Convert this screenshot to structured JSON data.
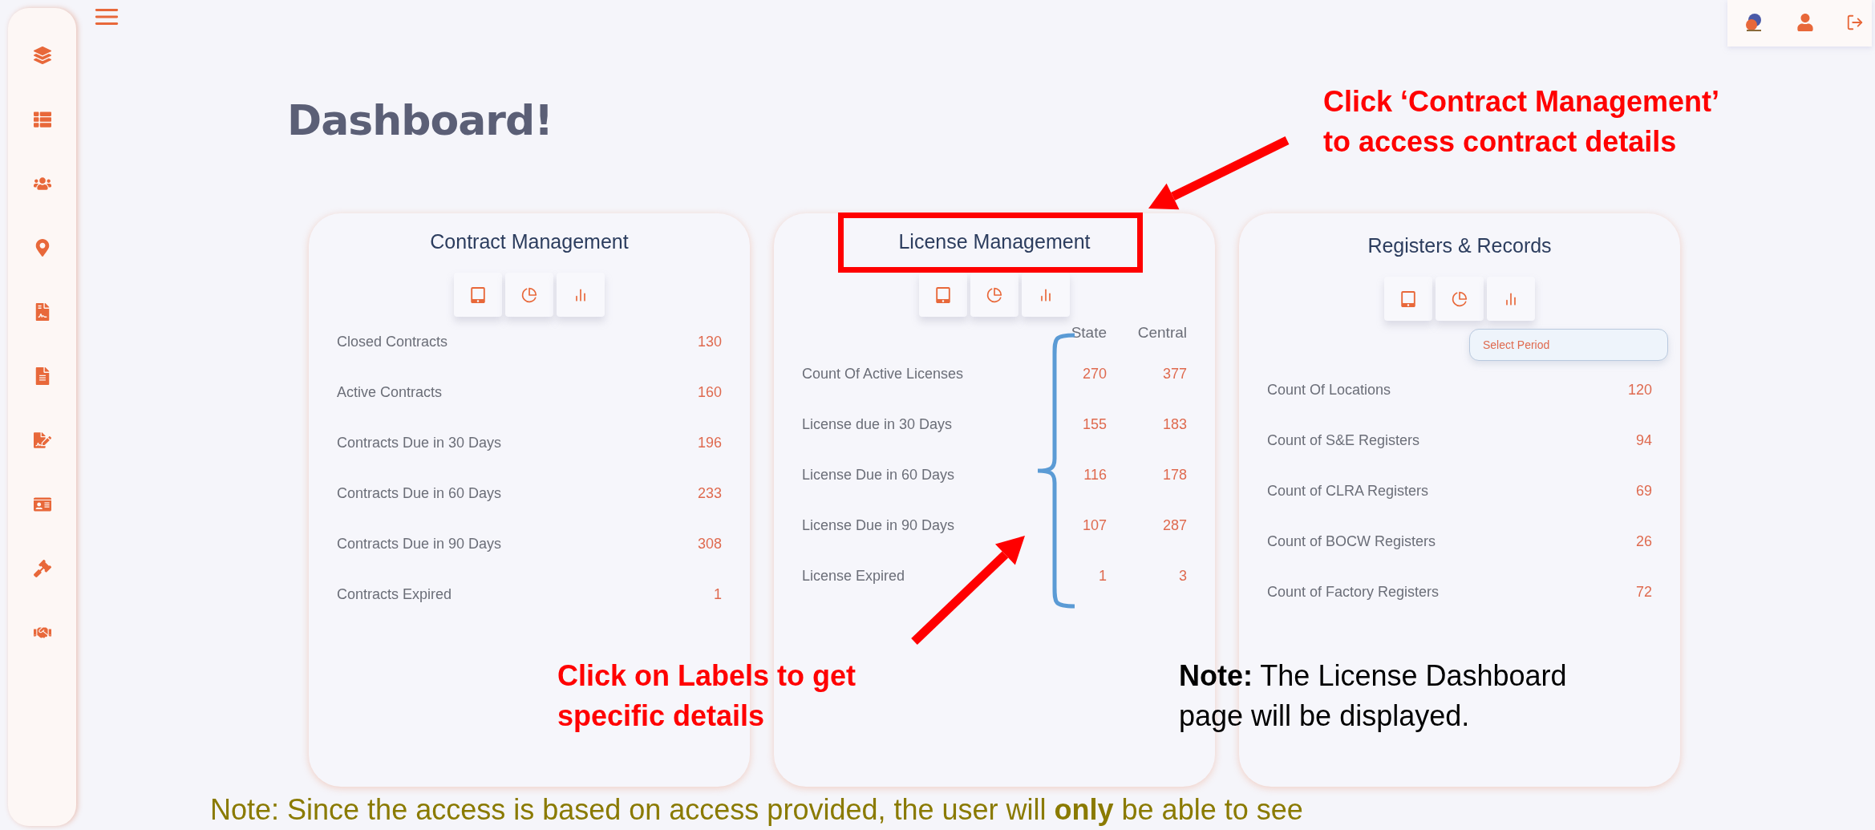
{
  "page_title": "Dashboard!",
  "cards": [
    {
      "kind": "single",
      "title": "Contract Management",
      "rows": [
        {
          "label": "Closed Contracts",
          "value": "130"
        },
        {
          "label": "Active Contracts",
          "value": "160"
        },
        {
          "label": "Contracts Due in 30 Days",
          "value": "196"
        },
        {
          "label": "Contracts Due in 60 Days",
          "value": "233"
        },
        {
          "label": "Contracts Due in 90 Days",
          "value": "308"
        },
        {
          "label": "Contracts Expired",
          "value": "1"
        }
      ]
    },
    {
      "kind": "dual",
      "title": "License Management",
      "columns": [
        "State",
        "Central"
      ],
      "rows": [
        {
          "label": "Count Of Active Licenses",
          "values": [
            "270",
            "377"
          ]
        },
        {
          "label": "License due in 30 Days",
          "values": [
            "155",
            "183"
          ]
        },
        {
          "label": "License Due in 60 Days",
          "values": [
            "116",
            "178"
          ]
        },
        {
          "label": "License Due in 90 Days",
          "values": [
            "107",
            "287"
          ]
        },
        {
          "label": "License Expired",
          "values": [
            "1",
            "3"
          ]
        }
      ]
    },
    {
      "kind": "single",
      "title": "Registers & Records",
      "period_select": {
        "placeholder": "Select Period"
      },
      "rows": [
        {
          "label": "Count Of Locations",
          "value": "120"
        },
        {
          "label": "Count of S&E Registers",
          "value": "94"
        },
        {
          "label": "Count of CLRA Registers",
          "value": "69"
        },
        {
          "label": "Count of BOCW Registers",
          "value": "26"
        },
        {
          "label": "Count of Factory Registers",
          "value": "72"
        }
      ]
    }
  ],
  "annotations": [
    {
      "kind": "callout",
      "lines": [
        "Click ‘Contract Management’",
        "to access contract details"
      ]
    },
    {
      "kind": "callout",
      "lines": [
        "Click on Labels to get",
        "specific details"
      ]
    },
    {
      "kind": "note",
      "lines": [
        "**Note:** The License Dashboard",
        "page will be displayed."
      ]
    },
    {
      "kind": "footer",
      "lines": [
        "Note: Since the access is based on access provided, the user will **only** be able to see"
      ]
    }
  ]
}
